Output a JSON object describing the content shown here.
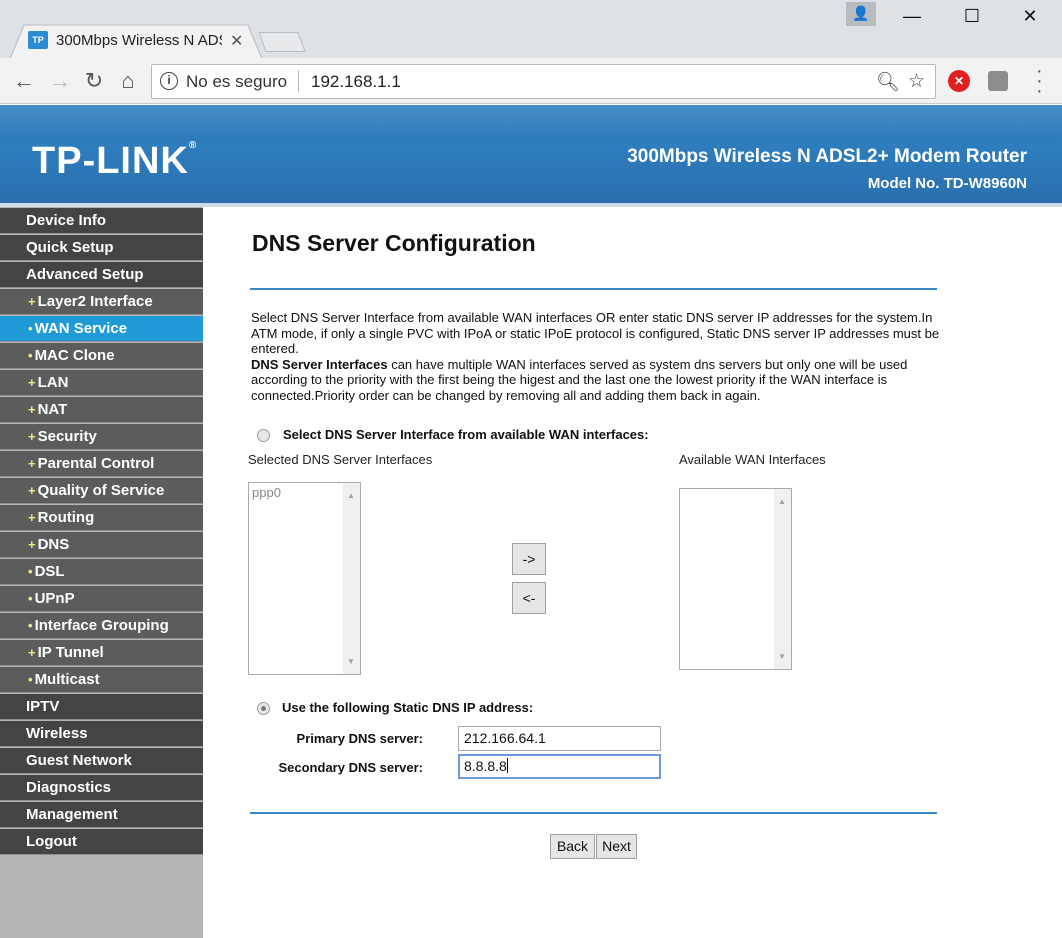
{
  "browser": {
    "tab_title": "300Mbps Wireless N ADSL2+ Modem Router",
    "favicon_text": "TP",
    "security_text": "No es seguro",
    "url": "192.168.1.1",
    "extension_ad_text": "✕"
  },
  "header": {
    "logo": "TP-LINK",
    "logo_reg": "®",
    "product_name": "300Mbps Wireless N ADSL2+ Modem Router",
    "model_no": "Model No. TD-W8960N"
  },
  "sidebar": {
    "items": [
      {
        "label": "Device Info",
        "type": "main"
      },
      {
        "label": "Quick Setup",
        "type": "main"
      },
      {
        "label": "Advanced Setup",
        "type": "main"
      },
      {
        "label": "Layer2 Interface",
        "type": "sub",
        "bullet": "+"
      },
      {
        "label": "WAN Service",
        "type": "sub",
        "bullet": "•",
        "active": true
      },
      {
        "label": "MAC Clone",
        "type": "sub",
        "bullet": "•"
      },
      {
        "label": "LAN",
        "type": "sub",
        "bullet": "+"
      },
      {
        "label": "NAT",
        "type": "sub",
        "bullet": "+"
      },
      {
        "label": "Security",
        "type": "sub",
        "bullet": "+"
      },
      {
        "label": "Parental Control",
        "type": "sub",
        "bullet": "+"
      },
      {
        "label": "Quality of Service",
        "type": "sub",
        "bullet": "+"
      },
      {
        "label": "Routing",
        "type": "sub",
        "bullet": "+"
      },
      {
        "label": "DNS",
        "type": "sub",
        "bullet": "+"
      },
      {
        "label": "DSL",
        "type": "sub",
        "bullet": "•"
      },
      {
        "label": "UPnP",
        "type": "sub",
        "bullet": "•"
      },
      {
        "label": "Interface Grouping",
        "type": "sub",
        "bullet": "•"
      },
      {
        "label": "IP Tunnel",
        "type": "sub",
        "bullet": "+"
      },
      {
        "label": "Multicast",
        "type": "sub",
        "bullet": "•"
      },
      {
        "label": "IPTV",
        "type": "main"
      },
      {
        "label": "Wireless",
        "type": "main"
      },
      {
        "label": "Guest Network",
        "type": "main"
      },
      {
        "label": "Diagnostics",
        "type": "main"
      },
      {
        "label": "Management",
        "type": "main"
      },
      {
        "label": "Logout",
        "type": "main"
      }
    ]
  },
  "main": {
    "title": "DNS Server Configuration",
    "description_p1": "Select DNS Server Interface from available WAN interfaces OR enter static DNS server IP addresses for the system.In ATM mode, if only a single PVC with IPoA or static IPoE protocol is configured, Static DNS server IP addresses must be entered.",
    "description_bold": "DNS Server Interfaces",
    "description_p2": " can have multiple WAN interfaces served as system dns servers but only one will be used according to the priority with the first being the higest and the last one the lowest priority if the WAN interface is connected.Priority order can be changed by removing all and adding them back in again.",
    "radio_interface_label": "Select DNS Server Interface from available WAN interfaces:",
    "selected_label": "Selected DNS Server Interfaces",
    "available_label": "Available WAN Interfaces",
    "selected_items": [
      "ppp0"
    ],
    "add_button": "->",
    "remove_button": "<-",
    "radio_static_label": "Use the following Static DNS IP address:",
    "primary_label": "Primary DNS server:",
    "primary_value": "212.166.64.1",
    "secondary_label": "Secondary DNS server:",
    "secondary_value": "8.8.8.8",
    "back_button": "Back",
    "next_button": "Next"
  }
}
